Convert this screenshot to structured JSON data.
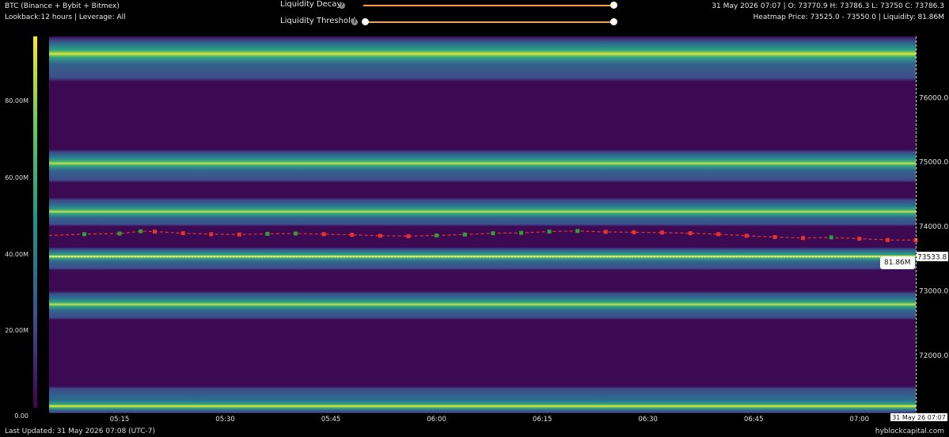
{
  "header": {
    "instrument": "BTC (Binance + Bybit + Bitmex)",
    "lookback": "Lookback:12 hours | Leverage: All",
    "ohlc": "31 May 2026 07:07 | O: 73770.9 H: 73786.3 L: 73750 C: 73786.3",
    "heatmap_info": "Heatmap Price: 73525.0 - 73550.0 | Liquidity: 81.86M"
  },
  "controls": {
    "decay_label": "Liquidity Decay",
    "threshold_label": "Liquidity Threshold",
    "info_glyph": "?",
    "decay_value": 1.0,
    "threshold_range": [
      0.0,
      1.0
    ]
  },
  "colors": {
    "accent": "#f2a33a",
    "background": "#000000",
    "heatmap_low": "#440154",
    "heatmap_high": "#fde725",
    "candle_up": "#2e9e3a",
    "candle_down": "#e8322c"
  },
  "footer": {
    "last_updated": "Last Updated: 31 May 2026 07:08 (UTC-7)",
    "brand": "hyblockcapital.com"
  },
  "chart_data": {
    "type": "heatmap",
    "title": "",
    "colorbar": {
      "ticks": [
        "0.00",
        "20.00M",
        "40.00M",
        "60.00M",
        "80.00M"
      ],
      "tick_values": [
        0,
        20,
        40,
        60,
        80
      ],
      "max": 97
    },
    "x_ticks": [
      "05:15",
      "05:30",
      "05:45",
      "06:00",
      "06:15",
      "06:30",
      "06:45",
      "07:00"
    ],
    "x_tick_minutes": [
      15,
      30,
      45,
      60,
      75,
      90,
      105,
      120
    ],
    "x_minute_range": [
      5,
      128
    ],
    "x_current_label": "31 May 26 07:07",
    "y_ticks": [
      "72000.0",
      "73000.0",
      "74000.0",
      "75000.0",
      "76000.0"
    ],
    "y_tick_values": [
      72000,
      73000,
      74000,
      75000,
      76000
    ],
    "ylim": [
      71100,
      76950
    ],
    "current_price_label": "73533.8",
    "current_price": 73533.8,
    "tooltip_value": "81.86M",
    "liquidity_bands": [
      {
        "price_low": 71100,
        "price_high": 71520,
        "peak_price": 71210,
        "intensity": 0.85
      },
      {
        "price_low": 72550,
        "price_high": 73000,
        "peak_price": 72790,
        "intensity": 0.78
      },
      {
        "price_low": 73320,
        "price_high": 73680,
        "peak_price": 73533,
        "intensity": 0.84
      },
      {
        "price_low": 74000,
        "price_high": 74450,
        "peak_price": 74230,
        "intensity": 0.82
      },
      {
        "price_low": 74680,
        "price_high": 75200,
        "peak_price": 74980,
        "intensity": 0.8
      },
      {
        "price_low": 76250,
        "price_high": 76950,
        "peak_price": 76680,
        "intensity": 0.88
      }
    ],
    "price_series": {
      "minutes": [
        5,
        10,
        15,
        18,
        20,
        24,
        28,
        32,
        36,
        40,
        44,
        48,
        52,
        56,
        60,
        64,
        68,
        72,
        76,
        80,
        84,
        88,
        92,
        96,
        100,
        104,
        108,
        112,
        116,
        120,
        124,
        128
      ],
      "values": [
        73860,
        73880,
        73890,
        73925,
        73920,
        73895,
        73880,
        73875,
        73885,
        73890,
        73880,
        73870,
        73855,
        73850,
        73860,
        73875,
        73895,
        73900,
        73920,
        73930,
        73915,
        73910,
        73905,
        73895,
        73880,
        73855,
        73835,
        73820,
        73830,
        73810,
        73790,
        73786
      ]
    }
  }
}
